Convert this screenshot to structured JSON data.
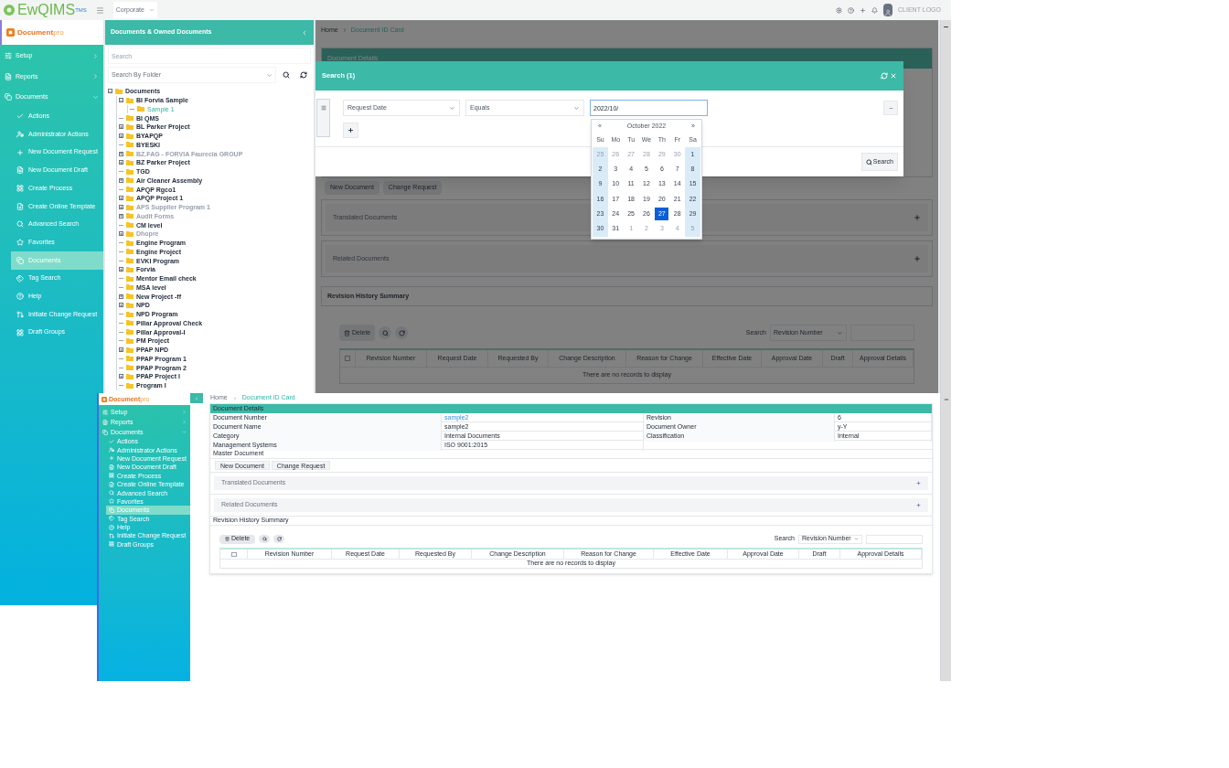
{
  "back_window": {
    "top_bar": {
      "logo": "EwQIMS",
      "logo_badge": "TMS",
      "site": "Corporate",
      "client_logo": "CLIENT LOGO"
    },
    "sidebar": {
      "logo": "Document",
      "logo_suffix": "pro",
      "items": [
        {
          "label": "Setup",
          "expanded": false,
          "selected": false
        },
        {
          "label": "Reports",
          "expanded": false,
          "selected": false
        },
        {
          "label": "Documents",
          "expanded": true,
          "selected": false,
          "children": [
            {
              "label": "Actions",
              "selected": false
            },
            {
              "label": "Administrator Actions",
              "selected": false
            },
            {
              "label": "New Document Request",
              "selected": false
            },
            {
              "label": "New Document Draft",
              "selected": false
            },
            {
              "label": "Create Process",
              "selected": false
            },
            {
              "label": "Create Online Template",
              "selected": false
            },
            {
              "label": "Advanced Search",
              "selected": false
            },
            {
              "label": "Favorites",
              "selected": false
            },
            {
              "label": "Documents",
              "selected": true
            },
            {
              "label": "Tag Search",
              "selected": false
            },
            {
              "label": "Help",
              "selected": false
            },
            {
              "label": "Initiate Change Request",
              "selected": false
            },
            {
              "label": "Draft Groups",
              "selected": false
            }
          ]
        }
      ]
    },
    "folder_panel": {
      "title": "Documents & Owned Documents",
      "search_placeholder": "Search",
      "folder_select": "Search By Folder",
      "tree": [
        {
          "label": "Documents",
          "expandable": true,
          "selected": false,
          "disabled": false,
          "children": [
            {
              "label": "BI Forvia Sample",
              "expandable": true,
              "selected": false,
              "disabled": false,
              "children": [
                {
                  "label": "Sample 1",
                  "expandable": false,
                  "selected": true,
                  "disabled": false
                }
              ]
            },
            {
              "label": "BI QMS",
              "expandable": false,
              "selected": false,
              "disabled": false
            },
            {
              "label": "BL Parker Project",
              "expandable": true,
              "selected": false,
              "disabled": false
            },
            {
              "label": "BYAPQP",
              "expandable": true,
              "selected": false,
              "disabled": false
            },
            {
              "label": "BYESKI",
              "expandable": false,
              "selected": false,
              "disabled": false
            },
            {
              "label": "BZ.FAG - FORVIA Faurecia GROUP",
              "expandable": true,
              "selected": false,
              "disabled": true
            },
            {
              "label": "BZ Parker Project",
              "expandable": true,
              "selected": false,
              "disabled": false
            },
            {
              "label": "TGD",
              "expandable": false,
              "selected": false,
              "disabled": false
            },
            {
              "label": "Air Cleaner Assembly",
              "expandable": true,
              "selected": false,
              "disabled": false
            },
            {
              "label": "APQP Rgco1",
              "expandable": false,
              "selected": false,
              "disabled": false
            },
            {
              "label": "APQP Project 1",
              "expandable": true,
              "selected": false,
              "disabled": false
            },
            {
              "label": "APS Supplier Program 1",
              "expandable": true,
              "selected": false,
              "disabled": true
            },
            {
              "label": "Audit Forms",
              "expandable": true,
              "selected": false,
              "disabled": true
            },
            {
              "label": "CM level",
              "expandable": false,
              "selected": false,
              "disabled": false
            },
            {
              "label": "Dhopre",
              "expandable": true,
              "selected": false,
              "disabled": true
            },
            {
              "label": "Engine Program",
              "expandable": false,
              "selected": false,
              "disabled": false
            },
            {
              "label": "Engine Project",
              "expandable": false,
              "selected": false,
              "disabled": false
            },
            {
              "label": "EVKI Program",
              "expandable": false,
              "selected": false,
              "disabled": false
            },
            {
              "label": "Forvia",
              "expandable": true,
              "selected": false,
              "disabled": false
            },
            {
              "label": "Mentor Email check",
              "expandable": false,
              "selected": false,
              "disabled": false
            },
            {
              "label": "MSA level",
              "expandable": false,
              "selected": false,
              "disabled": false
            },
            {
              "label": "New Project -ff",
              "expandable": true,
              "selected": false,
              "disabled": false
            },
            {
              "label": "NPD",
              "expandable": true,
              "selected": false,
              "disabled": false
            },
            {
              "label": "NPD Program",
              "expandable": false,
              "selected": false,
              "disabled": false
            },
            {
              "label": "Pillar Approval Check",
              "expandable": false,
              "selected": false,
              "disabled": false
            },
            {
              "label": "Pillar Approval-I",
              "expandable": false,
              "selected": false,
              "disabled": false
            },
            {
              "label": "PM Project",
              "expandable": false,
              "selected": false,
              "disabled": false
            },
            {
              "label": "PPAP NPD",
              "expandable": true,
              "selected": false,
              "disabled": false
            },
            {
              "label": "PPAP Program 1",
              "expandable": false,
              "selected": false,
              "disabled": false
            },
            {
              "label": "PPAP Program 2",
              "expandable": false,
              "selected": false,
              "disabled": false
            },
            {
              "label": "PPAP Project I",
              "expandable": true,
              "selected": false,
              "disabled": false
            },
            {
              "label": "Program I",
              "expandable": false,
              "selected": false,
              "disabled": false
            }
          ]
        }
      ]
    },
    "page": {
      "breadcrumb": [
        "Home",
        "Document ID Card"
      ],
      "details_title": "Document Details",
      "buttons": [
        "New Document",
        "Change Request"
      ],
      "panels": [
        {
          "title": "Translated Documents"
        },
        {
          "title": "Related Documents"
        }
      ],
      "history_title": "Revision History Summary",
      "toolbar": {
        "delete": "Delete",
        "search_label": "Search",
        "search_field": "Revision Number"
      },
      "select_all_checked": false,
      "columns": [
        "Revision Number",
        "Request Date",
        "Requested By",
        "Change Description",
        "Reason for Change",
        "Effective Date",
        "Approval Date",
        "Draft",
        "Approval Details"
      ],
      "empty_message": "There are no records to display"
    },
    "search_dialog": {
      "title": "Search (1)",
      "field": "Request Date",
      "operator": "Equals",
      "value": "2022/10/",
      "search_button": "Search",
      "calendar": {
        "month": "October 2022",
        "prev": "«",
        "next": "»",
        "weekdays": [
          "Su",
          "Mo",
          "Tu",
          "We",
          "Th",
          "Fr",
          "Sa"
        ],
        "weeks": [
          [
            {
              "day": "25",
              "outside": true,
              "selected": false
            },
            {
              "day": "26",
              "outside": true,
              "selected": false
            },
            {
              "day": "27",
              "outside": true,
              "selected": false
            },
            {
              "day": "28",
              "outside": true,
              "selected": false
            },
            {
              "day": "29",
              "outside": true,
              "selected": false
            },
            {
              "day": "30",
              "outside": true,
              "selected": false
            },
            {
              "day": "1",
              "outside": false,
              "selected": false
            }
          ],
          [
            {
              "day": "2",
              "outside": false,
              "selected": false
            },
            {
              "day": "3",
              "outside": false,
              "selected": false
            },
            {
              "day": "4",
              "outside": false,
              "selected": false
            },
            {
              "day": "5",
              "outside": false,
              "selected": false
            },
            {
              "day": "6",
              "outside": false,
              "selected": false
            },
            {
              "day": "7",
              "outside": false,
              "selected": false
            },
            {
              "day": "8",
              "outside": false,
              "selected": false
            }
          ],
          [
            {
              "day": "9",
              "outside": false,
              "selected": false
            },
            {
              "day": "10",
              "outside": false,
              "selected": false
            },
            {
              "day": "11",
              "outside": false,
              "selected": false
            },
            {
              "day": "12",
              "outside": false,
              "selected": false
            },
            {
              "day": "13",
              "outside": false,
              "selected": false
            },
            {
              "day": "14",
              "outside": false,
              "selected": false
            },
            {
              "day": "15",
              "outside": false,
              "selected": false
            }
          ],
          [
            {
              "day": "16",
              "outside": false,
              "selected": false
            },
            {
              "day": "17",
              "outside": false,
              "selected": false
            },
            {
              "day": "18",
              "outside": false,
              "selected": false
            },
            {
              "day": "19",
              "outside": false,
              "selected": false
            },
            {
              "day": "20",
              "outside": false,
              "selected": false
            },
            {
              "day": "21",
              "outside": false,
              "selected": false
            },
            {
              "day": "22",
              "outside": false,
              "selected": false
            }
          ],
          [
            {
              "day": "23",
              "outside": false,
              "selected": false
            },
            {
              "day": "24",
              "outside": false,
              "selected": false
            },
            {
              "day": "25",
              "outside": false,
              "selected": false
            },
            {
              "day": "26",
              "outside": false,
              "selected": false
            },
            {
              "day": "27",
              "outside": false,
              "selected": true
            },
            {
              "day": "28",
              "outside": false,
              "selected": false
            },
            {
              "day": "29",
              "outside": false,
              "selected": false
            }
          ],
          [
            {
              "day": "30",
              "outside": false,
              "selected": false
            },
            {
              "day": "31",
              "outside": false,
              "selected": false
            },
            {
              "day": "1",
              "outside": true,
              "selected": false
            },
            {
              "day": "2",
              "outside": true,
              "selected": false
            },
            {
              "day": "3",
              "outside": true,
              "selected": false
            },
            {
              "day": "4",
              "outside": true,
              "selected": false
            },
            {
              "day": "5",
              "outside": true,
              "selected": false
            }
          ]
        ]
      }
    }
  },
  "front_window": {
    "sidebar": {
      "logo": "Document",
      "logo_suffix": "pro",
      "items": [
        {
          "label": "Setup",
          "expanded": false,
          "selected": false
        },
        {
          "label": "Reports",
          "expanded": false,
          "selected": false
        },
        {
          "label": "Documents",
          "expanded": true,
          "selected": false,
          "children": [
            {
              "label": "Actions",
              "selected": false
            },
            {
              "label": "Administrator Actions",
              "selected": false
            },
            {
              "label": "New Document Request",
              "selected": false
            },
            {
              "label": "New Document Draft",
              "selected": false
            },
            {
              "label": "Create Process",
              "selected": false
            },
            {
              "label": "Create Online Template",
              "selected": false
            },
            {
              "label": "Advanced Search",
              "selected": false
            },
            {
              "label": "Favorites",
              "selected": false
            },
            {
              "label": "Documents",
              "selected": true
            },
            {
              "label": "Tag Search",
              "selected": false
            },
            {
              "label": "Help",
              "selected": false
            },
            {
              "label": "Initiate Change Request",
              "selected": false
            },
            {
              "label": "Draft Groups",
              "selected": false
            }
          ]
        }
      ]
    },
    "page": {
      "breadcrumb": [
        "Home",
        "Document ID Card"
      ],
      "details_title": "Document Details",
      "details": [
        {
          "label": "Document Number",
          "value": "sample2",
          "kind": "link"
        },
        {
          "label": "Revision",
          "value": "6",
          "kind": "text"
        },
        {
          "label": "Document Name",
          "value": "sample2",
          "kind": "text"
        },
        {
          "label": "Document Owner",
          "value": "y-Y",
          "kind": "text"
        },
        {
          "label": "Category",
          "value": "Internal Documents",
          "kind": "text"
        },
        {
          "label": "Classification",
          "value": "Internal",
          "kind": "text"
        },
        {
          "label": "Management Systems",
          "value": "ISO 9001:2015",
          "kind": "text"
        }
      ],
      "master_title": "Master Document",
      "buttons": [
        "New Document",
        "Change Request"
      ],
      "panels": [
        {
          "title": "Translated Documents"
        },
        {
          "title": "Related Documents"
        }
      ],
      "history_title": "Revision History Summary",
      "toolbar": {
        "delete": "Delete",
        "search_label": "Search",
        "search_field": "Revision Number"
      },
      "select_all_checked": false,
      "columns": [
        "Revision Number",
        "Request Date",
        "Requested By",
        "Change Description",
        "Reason for Change",
        "Effective Date",
        "Approval Date",
        "Draft",
        "Approval Details"
      ],
      "empty_message": "There are no records to display"
    }
  }
}
